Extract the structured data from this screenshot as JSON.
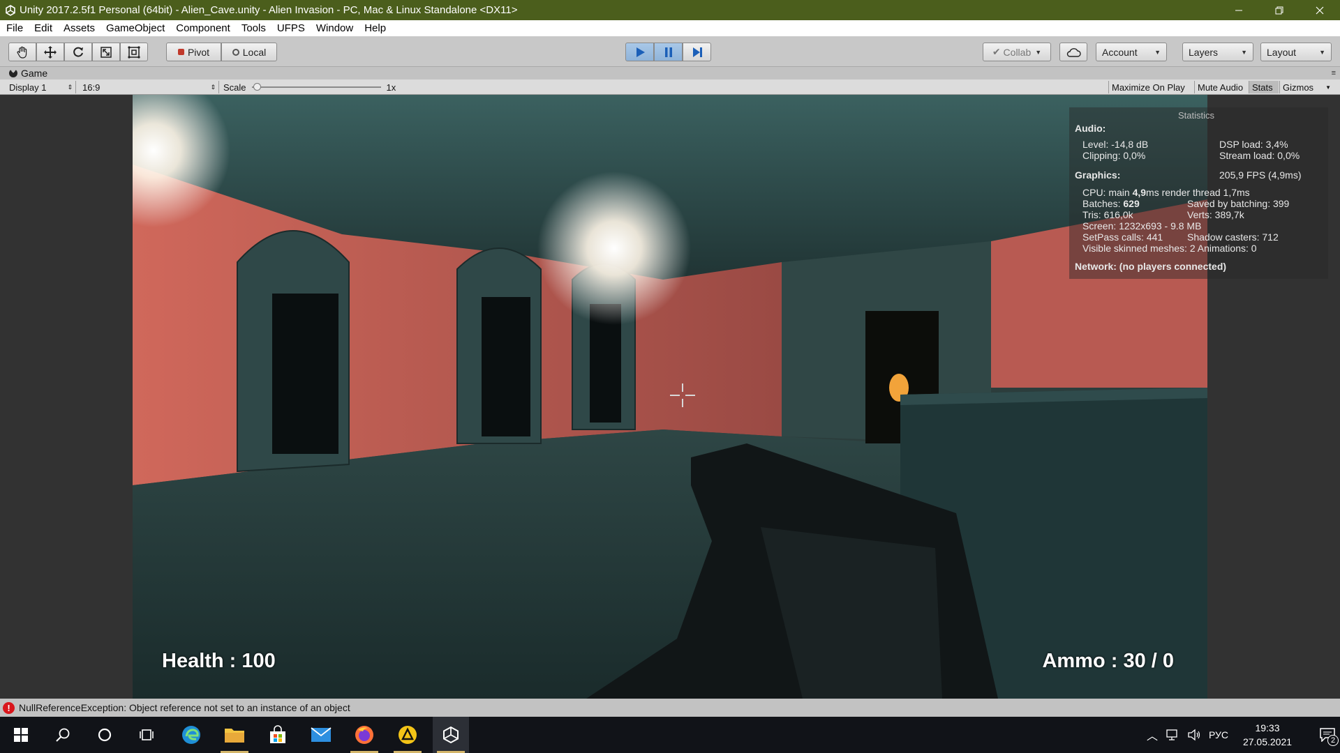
{
  "window": {
    "title": "Unity 2017.2.5f1 Personal (64bit) - Alien_Cave.unity - Alien Invasion - PC, Mac & Linux Standalone <DX11>"
  },
  "menu": [
    "File",
    "Edit",
    "Assets",
    "GameObject",
    "Component",
    "Tools",
    "UFPS",
    "Window",
    "Help"
  ],
  "toolbar": {
    "pivot_label": "Pivot",
    "local_label": "Local",
    "collab_label": "Collab",
    "account_label": "Account",
    "layers_label": "Layers",
    "layout_label": "Layout"
  },
  "game_tab": {
    "title": "Game",
    "display": "Display 1",
    "aspect": "16:9",
    "scale_label": "Scale",
    "scale_value": "1x",
    "maximize_label": "Maximize On Play",
    "mute_label": "Mute Audio",
    "stats_label": "Stats",
    "gizmos_label": "Gizmos"
  },
  "stats": {
    "title": "Statistics",
    "audio_header": "Audio:",
    "level": "Level: -14,8 dB",
    "clipping": "Clipping: 0,0%",
    "dsp": "DSP load: 3,4%",
    "stream": "Stream load: 0,0%",
    "graphics_header": "Graphics:",
    "fps": "205,9 FPS (4,9ms)",
    "cpu_prefix": "CPU: main ",
    "cpu_main": "4,9",
    "cpu_suffix": "ms  render thread 1,7ms",
    "batches_prefix": "Batches: ",
    "batches": "629",
    "saved_batching": "Saved by batching: 399",
    "tris": "Tris: 616,0k",
    "verts": "Verts: 389,7k",
    "screen": "Screen: 1232x693 - 9.8 MB",
    "setpass": "SetPass calls: 441",
    "shadow": "Shadow casters: 712",
    "skinned": "Visible skinned meshes: 2  Animations: 0",
    "network": "Network: (no players connected)"
  },
  "hud": {
    "health": "Health : 100",
    "ammo": "Ammo : 30 / 0"
  },
  "console": {
    "error": "NullReferenceException: Object reference not set to an instance of an object"
  },
  "taskbar": {
    "language": "РУС",
    "time": "19:33",
    "date": "27.05.2021",
    "notification_count": "2"
  },
  "colors": {
    "titlebar": "#4b5e1c",
    "play_active": "#8fb3d9",
    "error": "#d9161c",
    "taskbar": "#111318"
  }
}
